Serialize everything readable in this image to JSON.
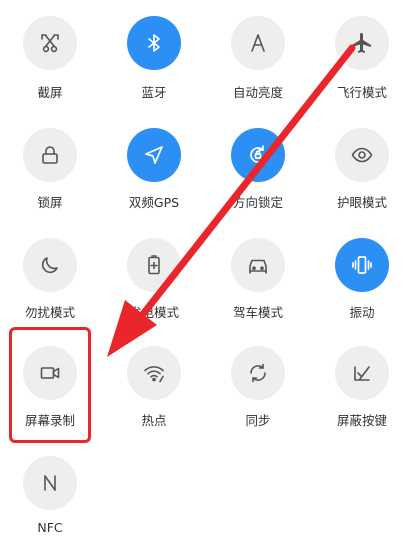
{
  "tiles": {
    "screenshot": {
      "label": "截屏",
      "active": false,
      "icon": "scissors-screenshot-icon"
    },
    "bluetooth": {
      "label": "蓝牙",
      "active": true,
      "icon": "bluetooth-icon"
    },
    "auto_brightness": {
      "label": "自动亮度",
      "active": false,
      "icon": "letter-a-icon"
    },
    "airplane_mode": {
      "label": "飞行模式",
      "active": false,
      "icon": "airplane-icon"
    },
    "lock_screen": {
      "label": "锁屏",
      "active": false,
      "icon": "lock-icon"
    },
    "dual_gps": {
      "label": "双频GPS",
      "active": true,
      "icon": "navigation-arrow-icon"
    },
    "orientation_lock": {
      "label": "方向锁定",
      "active": true,
      "icon": "rotation-lock-icon"
    },
    "eye_protection": {
      "label": "护眼模式",
      "active": false,
      "icon": "eye-icon"
    },
    "do_not_disturb": {
      "label": "勿扰模式",
      "active": false,
      "icon": "moon-icon"
    },
    "power_saving": {
      "label": "省电模式",
      "active": false,
      "icon": "battery-plus-icon"
    },
    "driving_mode": {
      "label": "驾车模式",
      "active": false,
      "icon": "car-icon"
    },
    "vibrate": {
      "label": "振动",
      "active": true,
      "icon": "vibrate-phone-icon"
    },
    "screen_recording": {
      "label": "屏幕录制",
      "active": false,
      "icon": "video-camera-icon"
    },
    "hotspot": {
      "label": "热点",
      "active": false,
      "icon": "hotspot-icon"
    },
    "sync": {
      "label": "同步",
      "active": false,
      "icon": "sync-icon"
    },
    "block_keys": {
      "label": "屏蔽按键",
      "active": false,
      "icon": "block-keys-icon"
    },
    "nfc": {
      "label": "NFC",
      "active": false,
      "icon": "nfc-icon"
    }
  },
  "colors": {
    "active_tile": "#2b8ff3",
    "inactive_tile": "#eeeeee",
    "icon_gray": "#555555",
    "label_text": "#333333",
    "annotation_red": "#e8262b"
  }
}
